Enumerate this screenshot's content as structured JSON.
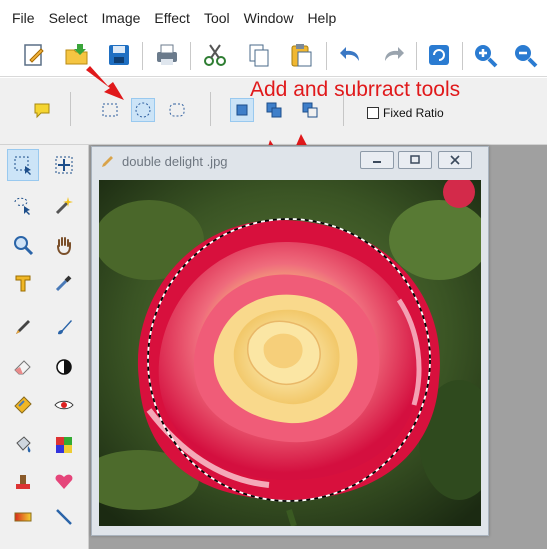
{
  "menu": [
    "File",
    "Select",
    "Image",
    "Effect",
    "Tool",
    "Window",
    "Help"
  ],
  "annotation": "Add and subrract tools",
  "options": {
    "fixed_ratio_label": "Fixed Ratio"
  },
  "document": {
    "title": "double delight .jpg"
  },
  "colors": {
    "annotation_red": "#e0191b",
    "selected_bg": "#cce4f7",
    "selected_border": "#99c9ef"
  }
}
